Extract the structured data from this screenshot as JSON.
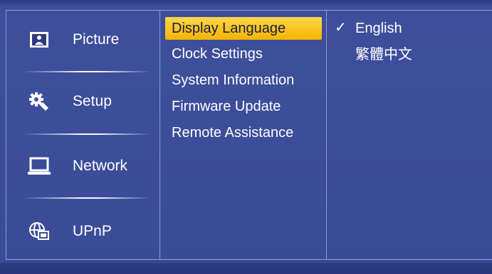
{
  "sidebar": {
    "items": [
      {
        "label": "Picture",
        "icon": "picture-icon"
      },
      {
        "label": "Setup",
        "icon": "gear-wrench-icon"
      },
      {
        "label": "Network",
        "icon": "laptop-icon"
      },
      {
        "label": "UPnP",
        "icon": "globe-screen-icon"
      }
    ]
  },
  "submenu": {
    "items": [
      {
        "label": "Display Language",
        "selected": true
      },
      {
        "label": "Clock Settings"
      },
      {
        "label": "System Information"
      },
      {
        "label": "Firmware Update"
      },
      {
        "label": "Remote Assistance"
      }
    ]
  },
  "language_options": {
    "check_mark": "✓",
    "items": [
      {
        "label": "English",
        "checked": true
      },
      {
        "label": "繁體中文",
        "checked": false
      }
    ]
  },
  "colors": {
    "background": "#3e4f9c",
    "highlight": "#f2b400",
    "text": "#ffffff"
  }
}
